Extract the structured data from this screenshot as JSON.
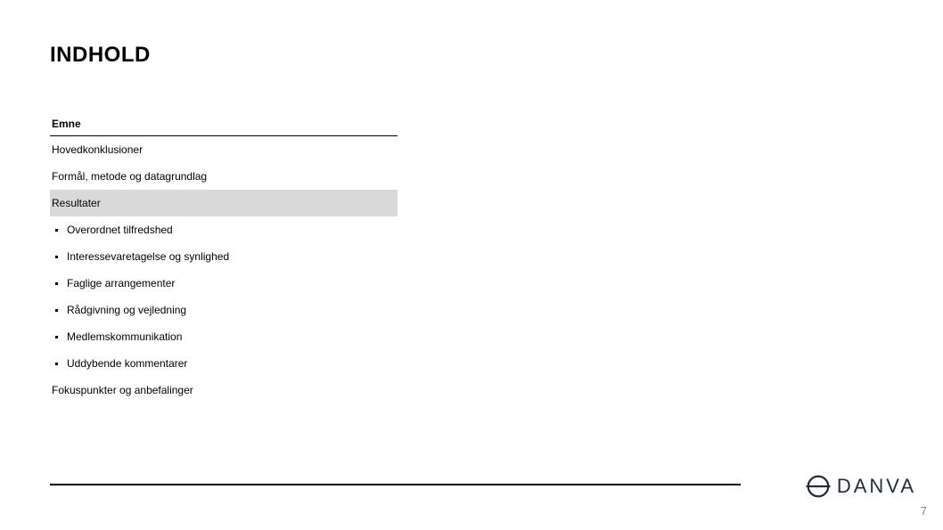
{
  "title": "INDHOLD",
  "toc": {
    "header": "Emne",
    "items": [
      "Hovedkonklusioner",
      "Formål, metode og datagrundlag"
    ],
    "highlighted": "Resultater",
    "subitems": [
      "Overordnet tilfredshed",
      "Interessevaretagelse og synlighed",
      "Faglige arrangementer",
      "Rådgivning og vejledning",
      "Medlemskommunikation",
      "Uddybende kommentarer"
    ],
    "footer_item": "Fokuspunkter og anbefalinger"
  },
  "logo": "DANVA",
  "page_number": "7"
}
